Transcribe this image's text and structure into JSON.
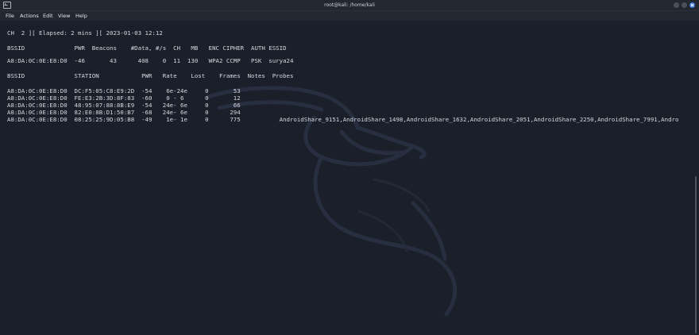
{
  "window": {
    "title": "root@kali: /home/kali",
    "icon": "terminal-icon"
  },
  "menu": [
    "File",
    "Actions",
    "Edit",
    "View",
    "Help"
  ],
  "terminal": {
    "status_line": "CH  2 ][ Elapsed: 2 mins ][ 2023-01-03 12:12",
    "ap_header": "BSSID              PWR  Beacons    #Data, #/s  CH   MB   ENC CIPHER  AUTH ESSID",
    "ap_rows": [
      "A8:DA:0C:0E:E8:D0  -46       43      408    0  11  130   WPA2 CCMP   PSK  surya24"
    ],
    "station_header": "BSSID              STATION            PWR   Rate    Lost    Frames  Notes  Probes",
    "station_rows": [
      "A8:DA:0C:0E:E8:D0  DC:F5:05:C8:E9:2D  -54    6e-24e     0       53",
      "A8:DA:0C:0E:E8:D0  FE:E3:2B:3D:8F:83  -60    0 - 6      0       12",
      "A8:DA:0C:0E:E8:D0  48:95:07:88:8B:E9  -54   24e- 6e     0       66",
      "A8:DA:0C:0E:E8:D0  82:E0:8B:D1:50:B7  -68   24e- 6e     0      294",
      "A8:DA:0C:0E:E8:D0  08:25:25:9D:05:B8  -49    1e- 1e     0      775           AndroidShare_9151,AndroidShare_1498,AndroidShare_1632,AndroidShare_2051,AndroidShare_2250,AndroidShare_7991,Andro"
    ]
  }
}
